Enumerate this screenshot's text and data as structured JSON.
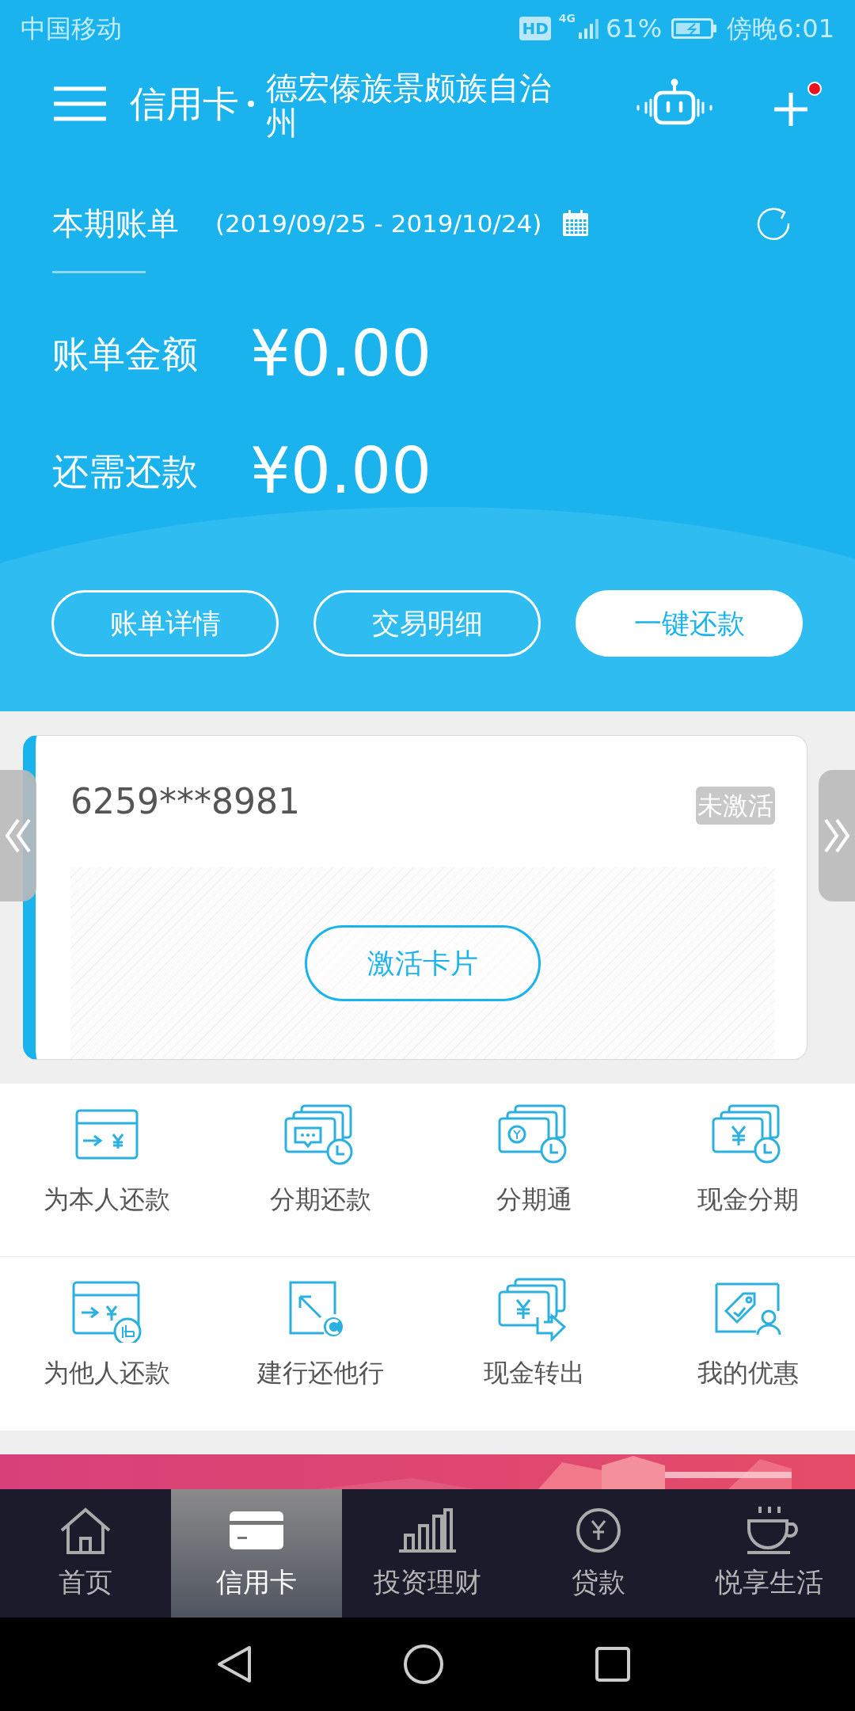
{
  "status_bar": {
    "carrier": "中国移动",
    "hd": "HD",
    "network": "4G",
    "battery": "61%",
    "time": "傍晚6:01"
  },
  "header": {
    "title": "信用卡",
    "region": "德宏傣族景颇族自治州",
    "notification": true
  },
  "bill": {
    "label": "本期账单",
    "period": "(2019/09/25 - 2019/10/24)",
    "rows": [
      {
        "label": "账单金额",
        "amount": "¥0.00"
      },
      {
        "label": "还需还款",
        "amount": "¥0.00"
      }
    ],
    "buttons": [
      {
        "label": "账单详情",
        "primary": false
      },
      {
        "label": "交易明细",
        "primary": false
      },
      {
        "label": "一键还款",
        "primary": true
      }
    ]
  },
  "card": {
    "number": "6259***8981",
    "status": "未激活",
    "action": "激活卡片"
  },
  "services": [
    {
      "label": "为本人还款",
      "kind": "self"
    },
    {
      "label": "分期还款",
      "kind": "installment"
    },
    {
      "label": "分期通",
      "kind": "installment-pass"
    },
    {
      "label": "现金分期",
      "kind": "cash-installment"
    },
    {
      "label": "为他人还款",
      "kind": "other"
    },
    {
      "label": "建行还他行",
      "kind": "interbank"
    },
    {
      "label": "现金转出",
      "kind": "cash-out"
    },
    {
      "label": "我的优惠",
      "kind": "offers"
    }
  ],
  "tabs": [
    {
      "label": "首页",
      "kind": "home",
      "selected": false
    },
    {
      "label": "信用卡",
      "kind": "card",
      "selected": true
    },
    {
      "label": "投资理财",
      "kind": "invest",
      "selected": false
    },
    {
      "label": "贷款",
      "kind": "loan",
      "selected": false
    },
    {
      "label": "悦享生活",
      "kind": "life",
      "selected": false
    }
  ]
}
